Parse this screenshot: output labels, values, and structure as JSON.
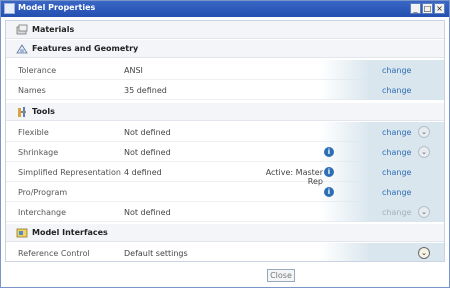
{
  "window": {
    "title": "Model Properties",
    "buttons": {
      "minimize": "_",
      "maximize": "□",
      "close": "×"
    }
  },
  "sections": [
    {
      "id": "materials",
      "label": "Materials",
      "icon": "materials-icon",
      "rows": []
    },
    {
      "id": "features",
      "label": "Features and Geometry",
      "icon": "features-geometry-icon",
      "rows": [
        {
          "name": "Tolerance",
          "value": "ANSI",
          "action": "change"
        },
        {
          "name": "Names",
          "value": "35 defined",
          "action": "change"
        }
      ]
    },
    {
      "id": "tools",
      "label": "Tools",
      "icon": "tools-icon",
      "rows": [
        {
          "name": "Flexible",
          "value": "Not defined",
          "action": "change"
        },
        {
          "name": "Shrinkage",
          "value": "Not defined",
          "action": "change"
        },
        {
          "name": "Simplified Representation",
          "value": "4 defined",
          "extra": "Active: Master Rep",
          "action": "change"
        },
        {
          "name": "Pro/Program",
          "value": "",
          "action": "change"
        },
        {
          "name": "Interchange",
          "value": "Not defined",
          "action": "change"
        }
      ]
    },
    {
      "id": "model_interfaces",
      "label": "Model Interfaces",
      "icon": "model-interfaces-icon",
      "rows": [
        {
          "name": "Reference Control",
          "value": "Default settings",
          "action": ""
        }
      ]
    }
  ],
  "info_icon": "i",
  "expand_icon": "⌄",
  "footer": {
    "close_label": "Close"
  }
}
